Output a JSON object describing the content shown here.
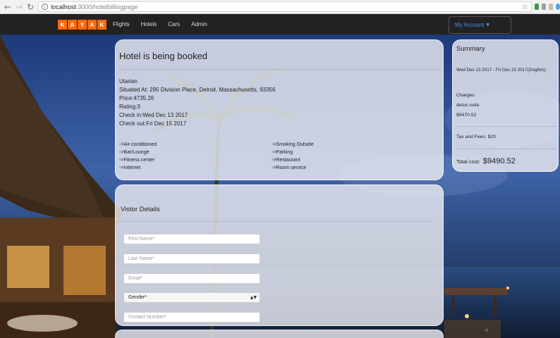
{
  "browser": {
    "url_host": "localhost",
    "url_path": ":3000/hotelbillingpage",
    "back_icon": "back-arrow-icon",
    "forward_icon": "forward-arrow-icon",
    "reload_icon": "reload-icon",
    "info_icon": "info-icon",
    "star_icon": "star-icon"
  },
  "navbar": {
    "logo_letters": [
      "K",
      "A",
      "Y",
      "A",
      "K"
    ],
    "links": [
      "Flights",
      "Hotels",
      "Cars",
      "Admin"
    ],
    "account_label": "My Account",
    "brand_color": "#ff690f",
    "accent_color": "#4a90e2"
  },
  "hotel": {
    "heading": "Hotel is being booked",
    "name": "Utarian",
    "address": "Situated At: 295 Division Place, Detroit, Massachusetts, 93356",
    "price": "Price:4735.26",
    "rating": "Rating:3",
    "check_in": "Check in:Wed Dec 13 2017",
    "check_out": "Check out:Fri Dec 15 2017",
    "amenities_left": [
      "->Air-conditioned",
      "->Bar/Lounge",
      "->Fitness center",
      "->Internet"
    ],
    "amenities_right": [
      "->Smoking Outside",
      "->Parking",
      "->Restaurant",
      "->Room service"
    ]
  },
  "summary": {
    "title": "Summary",
    "dates": "Wed Dec 13 2017 - Fri Dec 15 2017(2night/s)",
    "charges_label": "Charges",
    "room_type": "delux suite",
    "room_charge": "$9470.52",
    "tax": "Tax and Fees: $20",
    "total_label": "Total cost:",
    "total_value": "$9490.52"
  },
  "visitor": {
    "title": "Vistor Details",
    "first_name_placeholder": "First Name*",
    "last_name_placeholder": "Last Name*",
    "email_placeholder": "Email*",
    "gender_value": "Gender*",
    "contact_placeholder": "Contact Number*"
  }
}
